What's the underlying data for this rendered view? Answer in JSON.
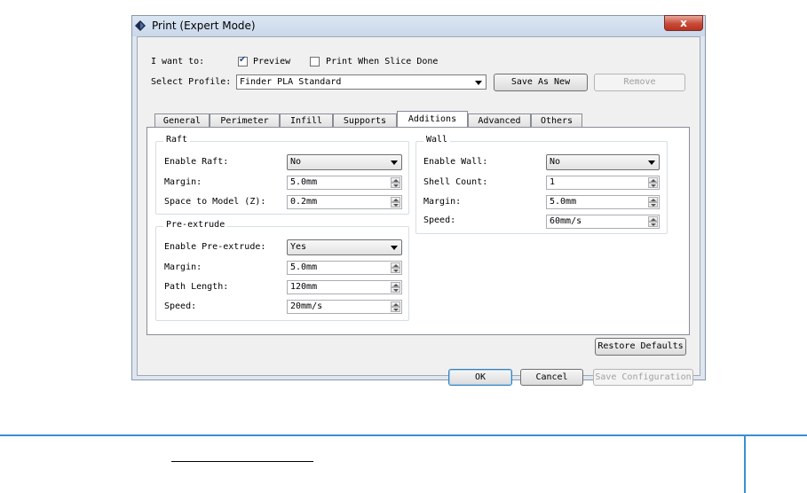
{
  "window": {
    "title": "Print (Expert Mode)",
    "close_glyph": "x"
  },
  "top": {
    "i_want_to_label": "I want to:",
    "preview_label": "Preview",
    "preview_checked": true,
    "print_when_done_label": "Print When Slice Done",
    "print_when_done_checked": false,
    "select_profile_label": "Select Profile:",
    "profile_value": "Finder PLA Standard",
    "save_as_new_label": "Save As New",
    "remove_label": "Remove"
  },
  "tabs": [
    {
      "label": "General",
      "active": false
    },
    {
      "label": "Perimeter",
      "active": false
    },
    {
      "label": "Infill",
      "active": false
    },
    {
      "label": "Supports",
      "active": false
    },
    {
      "label": "Additions",
      "active": true
    },
    {
      "label": "Advanced",
      "active": false
    },
    {
      "label": "Others",
      "active": false
    }
  ],
  "raft": {
    "title": "Raft",
    "enable_label": "Enable Raft:",
    "enable_value": "No",
    "margin_label": "Margin:",
    "margin_value": "5.0mm",
    "space_label": "Space to Model (Z):",
    "space_value": "0.2mm"
  },
  "preextrude": {
    "title": "Pre-extrude",
    "enable_label": "Enable Pre-extrude:",
    "enable_value": "Yes",
    "margin_label": "Margin:",
    "margin_value": "5.0mm",
    "path_label": "Path Length:",
    "path_value": "120mm",
    "speed_label": "Speed:",
    "speed_value": "20mm/s"
  },
  "wall": {
    "title": "Wall",
    "enable_label": "Enable Wall:",
    "enable_value": "No",
    "shell_label": "Shell Count:",
    "shell_value": "1",
    "margin_label": "Margin:",
    "margin_value": "5.0mm",
    "speed_label": "Speed:",
    "speed_value": "60mm/s"
  },
  "buttons": {
    "restore_defaults": "Restore Defaults",
    "ok": "OK",
    "cancel": "Cancel",
    "save_configuration": "Save Configuration"
  }
}
